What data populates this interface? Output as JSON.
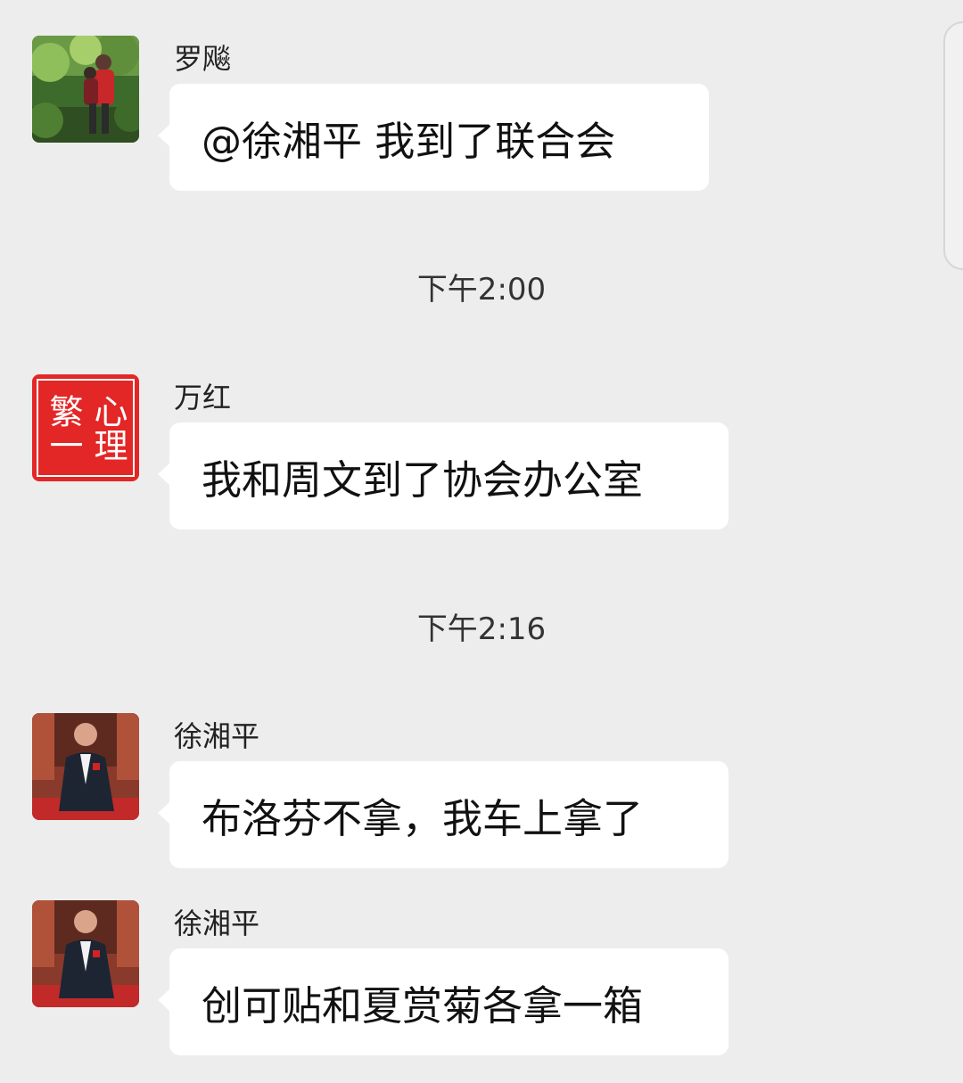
{
  "messages": [
    {
      "sender": "罗飚",
      "text": "@徐湘平  我到了联合会",
      "avatar_icon": "photo-avatar-garden"
    },
    {
      "sender": "万红",
      "text": "我和周文到了协会办公室",
      "avatar_icon": "seal-avatar-red"
    },
    {
      "sender": "徐湘平",
      "text": "布洛芬不拿，我车上拿了",
      "avatar_icon": "photo-avatar-man"
    },
    {
      "sender": "徐湘平",
      "text": "创可贴和夏赏菊各拿一箱",
      "avatar_icon": "photo-avatar-man"
    }
  ],
  "timestamps": [
    "下午2:00",
    "下午2:16"
  ],
  "avatar_seal_text": "心理繁一",
  "colors": {
    "background": "#ededed",
    "bubble": "#ffffff",
    "seal_red": "#e32626"
  }
}
